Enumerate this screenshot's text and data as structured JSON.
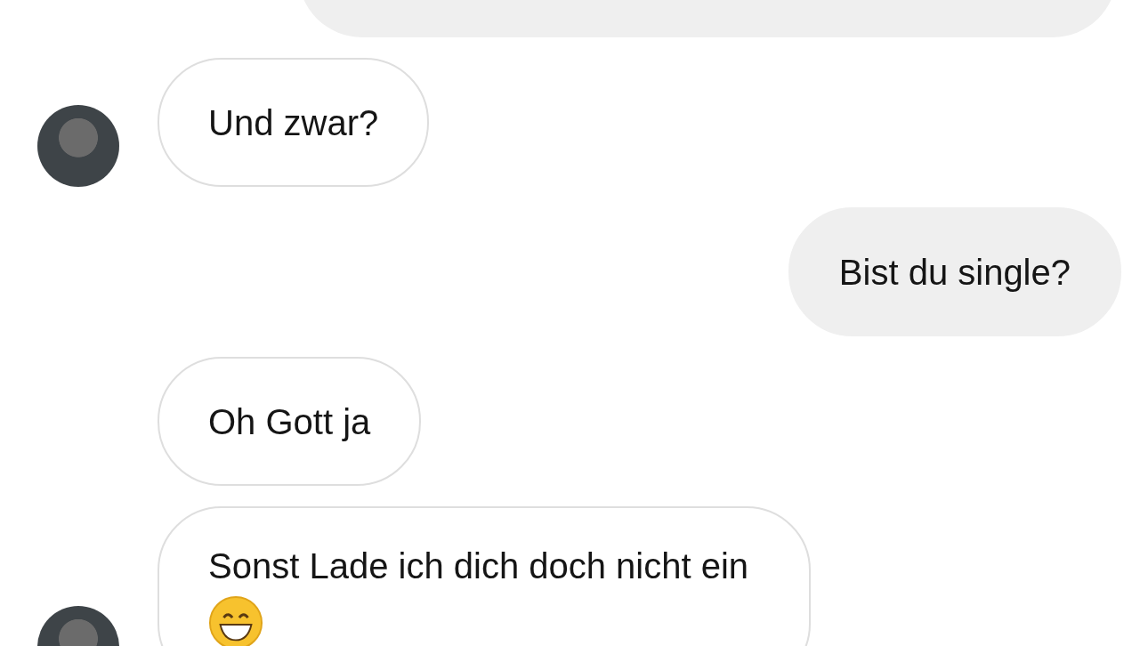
{
  "messages": [
    {
      "kind": "outgoing",
      "avatar": false
    },
    {
      "kind": "incoming",
      "avatar": true,
      "emoji": false,
      "text": "Und zwar?"
    },
    {
      "kind": "outgoing",
      "avatar": false,
      "emoji": false,
      "text": "Bist du single?"
    },
    {
      "kind": "incoming",
      "avatar": false,
      "emoji": false,
      "text": "Oh Gott ja"
    },
    {
      "kind": "incoming",
      "avatar": true,
      "emoji": true,
      "text": "Sonst Lade ich dich doch nicht ein"
    }
  ]
}
